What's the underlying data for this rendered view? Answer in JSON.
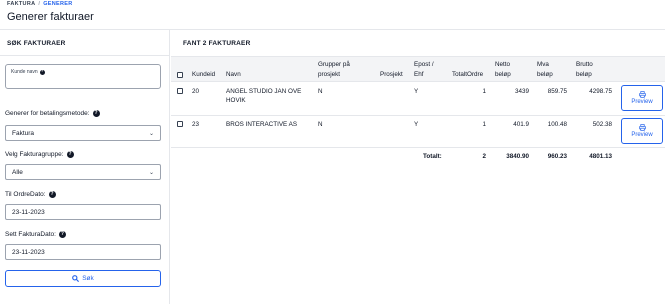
{
  "header": {
    "breadcrumb": [
      "FAKTURA",
      "/",
      "GENERER"
    ],
    "title": "Generer fakturaer"
  },
  "sidebar": {
    "title": "SØK FAKTURAER",
    "customer_name_label": "Kunde navn",
    "payment_method_label": "Generer for betalingsmetode:",
    "payment_method_value": "Faktura",
    "invoice_group_label": "Velg Fakturagruppe:",
    "invoice_group_value": "Alle",
    "to_order_date_label": "Til OrdreDato:",
    "to_order_date_value": "23-11-2023",
    "invoice_date_label": "Sett FakturaDato:",
    "invoice_date_value": "23-11-2023",
    "search_label": "Søk"
  },
  "main": {
    "title": "FANT 2 FAKTURAER",
    "columns": {
      "customer_id": "Kundeid",
      "name": "Navn",
      "group_line1": "Grupper på",
      "group_line2": "prosjekt",
      "project": "Prosjekt",
      "email_line1": "Epost /",
      "email_line2": "Ehf",
      "total_orders": "TotaltOrdre",
      "net_line1": "Netto",
      "net_line2": "beløp",
      "vat_line1": "Mva",
      "vat_line2": "beløp",
      "gross_line1": "Brutto",
      "gross_line2": "beløp"
    },
    "rows": [
      {
        "customer_id": "20",
        "name_line1": "ANGEL STUDIO JAN OVE",
        "name_line2": "HOVIK",
        "group": "N",
        "project": "",
        "email": "Y",
        "total_orders": "1",
        "net": "3439",
        "vat": "859.75",
        "gross": "4298.75",
        "preview_label": "Preview"
      },
      {
        "customer_id": "23",
        "name_line1": "BROS INTERACTIVE AS",
        "name_line2": "",
        "group": "N",
        "project": "",
        "email": "Y",
        "total_orders": "1",
        "net": "401.9",
        "vat": "100.48",
        "gross": "502.38",
        "preview_label": "Preview"
      }
    ],
    "totals": {
      "label": "Totalt:",
      "orders": "2",
      "net": "3840.90",
      "vat": "960.23",
      "gross": "4801.13"
    }
  },
  "colors": {
    "accent": "#2563eb",
    "header_bg": "#f3f4f6",
    "border": "#e5e7eb"
  },
  "icons": {
    "help": "question-circle-icon",
    "search": "magnifier-icon",
    "preview": "printer-icon",
    "dropdown": "chevron-down-icon"
  }
}
